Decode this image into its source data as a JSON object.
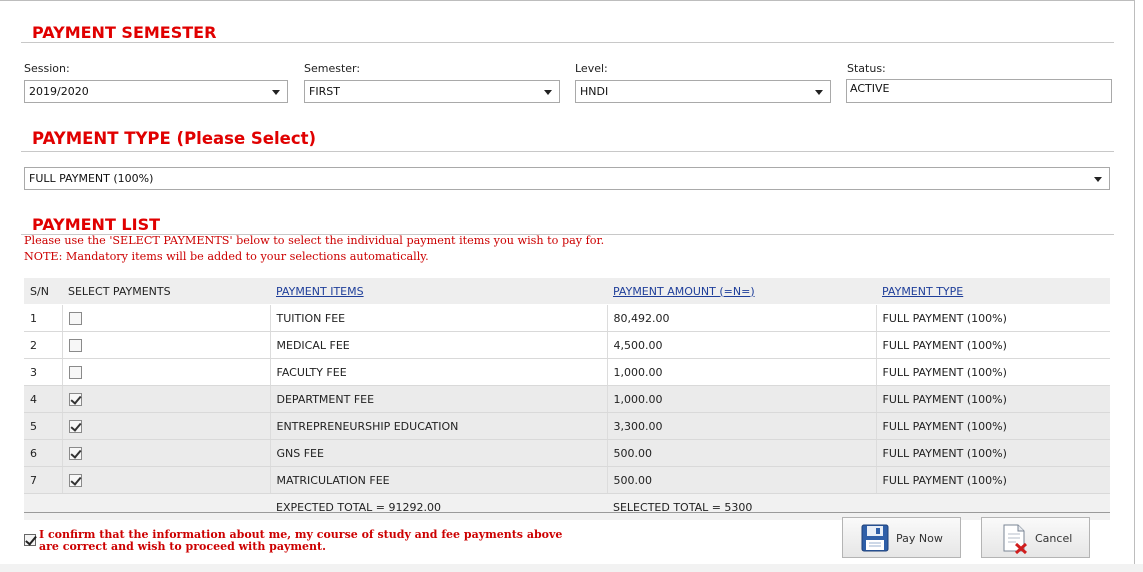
{
  "semester_section": {
    "title": "PAYMENT SEMESTER",
    "session": {
      "label": "Session:",
      "value": "2019/2020"
    },
    "semester": {
      "label": "Semester:",
      "value": "FIRST"
    },
    "level": {
      "label": "Level:",
      "value": "HNDI"
    },
    "status": {
      "label": "Status:",
      "value": "ACTIVE"
    }
  },
  "payment_type_section": {
    "title": "PAYMENT TYPE (Please Select)",
    "value": "FULL PAYMENT (100%)"
  },
  "payment_list_section": {
    "title": "PAYMENT LIST",
    "note1": "Please use the 'SELECT PAYMENTS' below to select the individual payment items you wish to pay for.",
    "note2": "NOTE: Mandatory items will be added to your selections automatically."
  },
  "table": {
    "headers": {
      "sn": "S/N",
      "select": "SELECT PAYMENTS",
      "items": "PAYMENT ITEMS",
      "amount": "PAYMENT AMOUNT (=N=)",
      "type": "PAYMENT TYPE"
    },
    "rows": [
      {
        "sn": "1",
        "checked": false,
        "item": "TUITION FEE",
        "amount": "80,492.00",
        "type": "FULL PAYMENT (100%)"
      },
      {
        "sn": "2",
        "checked": false,
        "item": "MEDICAL FEE",
        "amount": "4,500.00",
        "type": "FULL PAYMENT (100%)"
      },
      {
        "sn": "3",
        "checked": false,
        "item": "FACULTY FEE",
        "amount": "1,000.00",
        "type": "FULL PAYMENT (100%)"
      },
      {
        "sn": "4",
        "checked": true,
        "item": "DEPARTMENT FEE",
        "amount": "1,000.00",
        "type": "FULL PAYMENT (100%)"
      },
      {
        "sn": "5",
        "checked": true,
        "item": "ENTREPRENEURSHIP EDUCATION",
        "amount": "3,300.00",
        "type": "FULL PAYMENT (100%)"
      },
      {
        "sn": "6",
        "checked": true,
        "item": "GNS FEE",
        "amount": "500.00",
        "type": "FULL PAYMENT (100%)"
      },
      {
        "sn": "7",
        "checked": true,
        "item": "MATRICULATION FEE",
        "amount": "500.00",
        "type": "FULL PAYMENT (100%)"
      }
    ],
    "expected_total": "EXPECTED TOTAL = 91292.00",
    "selected_total": "SELECTED TOTAL = 5300"
  },
  "confirm": {
    "checked": true,
    "text": "I confirm that the information about me, my course of study and fee payments above are correct and wish to proceed with payment."
  },
  "buttons": {
    "pay_now": {
      "label": "Pay Now",
      "icon": "floppy-disk-icon"
    },
    "cancel": {
      "label": "Cancel",
      "icon": "document-cancel-icon"
    }
  },
  "colors": {
    "heading_red": "#e00000",
    "note_red": "#cc0000",
    "header_link": "#1f3f9a"
  }
}
